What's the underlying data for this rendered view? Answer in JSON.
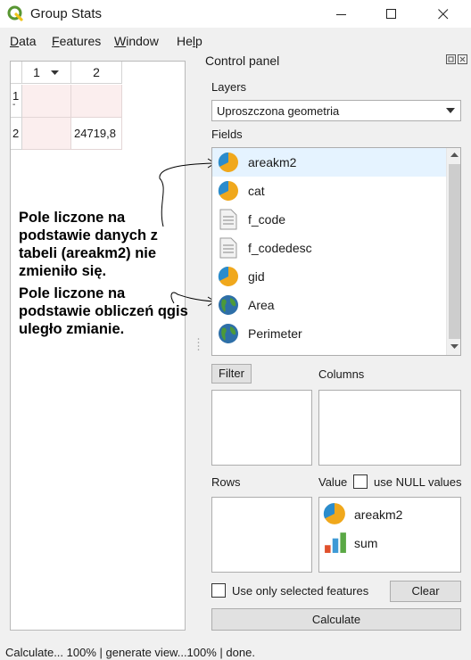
{
  "window": {
    "title": "Group Stats",
    "app_icon": "qgis-icon",
    "controls": [
      "minimize-icon",
      "maximize-icon",
      "close-icon"
    ]
  },
  "menu": {
    "items": [
      {
        "label": "Data"
      },
      {
        "label": "Features"
      },
      {
        "label": "Window"
      },
      {
        "label": "Help"
      }
    ]
  },
  "table": {
    "column_headers": [
      "1",
      "2"
    ],
    "sort_icon": "sort-down-icon",
    "row_headers": [
      "1",
      "2"
    ],
    "row_header_marker": "-",
    "rows": [
      [
        "",
        ""
      ],
      [
        "",
        "24719,8"
      ]
    ]
  },
  "annotation": {
    "text1": "Pole liczone na\npodstawie danych z\ntabeli (areakm2) nie\nzmieniło się.",
    "text2": "Pole liczone na\npodstawie obliczeń qgis\nuległo zmianie."
  },
  "control_panel": {
    "title": "Control panel",
    "layers_label": "Layers",
    "layer_selected": "Uproszczona geometria",
    "fields_label": "Fields",
    "fields": [
      {
        "label": "areakm2",
        "icon": "pie-chart-icon",
        "selected": true
      },
      {
        "label": "cat",
        "icon": "pie-chart-icon"
      },
      {
        "label": "f_code",
        "icon": "document-icon"
      },
      {
        "label": "f_codedesc",
        "icon": "document-icon"
      },
      {
        "label": "gid",
        "icon": "pie-chart-icon"
      },
      {
        "label": "Area",
        "icon": "globe-icon"
      },
      {
        "label": "Perimeter",
        "icon": "globe-icon"
      }
    ],
    "filter_button": "Filter",
    "columns_label": "Columns",
    "rows_label": "Rows",
    "value_label": "Value",
    "null_values_label": "use NULL values",
    "null_values_checked": false,
    "value_items": [
      {
        "label": "areakm2",
        "icon": "pie-chart-icon"
      },
      {
        "label": "sum",
        "icon": "bar-chart-icon"
      }
    ],
    "only_selected_label": "Use only selected features",
    "only_selected_checked": false,
    "clear_button": "Clear",
    "calculate_button": "Calculate"
  },
  "status": {
    "text": "Calculate... 100% |  generate view...100% |  done."
  },
  "colors": {
    "selection": "#e5f3ff",
    "pink_cell": "#fbeeee",
    "qgis_green": "#589632",
    "qgis_yellow": "#f0c419"
  }
}
